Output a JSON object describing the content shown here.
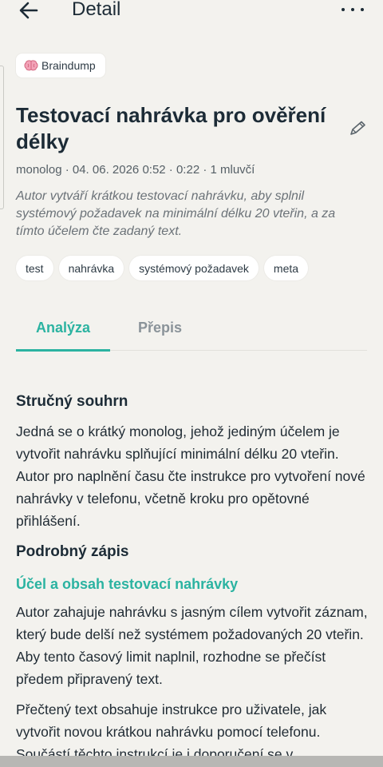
{
  "header": {
    "title": "Detail",
    "back_icon": "arrow-left-icon",
    "more_icon": "more-horizontal-icon"
  },
  "note": {
    "folder": "Braindump",
    "folder_icon": "brain-icon",
    "title": "Testovací nahrávka pro ověření délky",
    "edit_icon": "pencil-icon",
    "meta": "monolog · 04. 06. 2026 0:52 · 0:22 · 1 mluvčí",
    "summary": "Autor vytváří krátkou testovací nahrávku, aby splnil systémový požadavek na minimální délku 20 vteřin, a za tímto účelem čte zadaný text.",
    "tags": [
      "test",
      "nahrávka",
      "systémový požadavek",
      "meta"
    ]
  },
  "tabs": [
    {
      "label": "Analýza",
      "active": true
    },
    {
      "label": "Přepis",
      "active": false
    }
  ],
  "analysis": {
    "short_summary_heading": "Stručný souhrn",
    "short_summary": "Jedná se o krátký monolog, jehož jediným účelem je vytvořit nahrávku splňující minimální délku 20 vteřin. Autor pro naplnění času čte instrukce pro vytvoření nové nahrávky v telefonu, včetně kroku pro opětovné přihlášení.",
    "detail_heading": "Podrobný zápis",
    "section_heading": "Účel a obsah testovací nahrávky",
    "paragraph1": "Autor zahajuje nahrávku s jasným cílem vytvořit záznam, který bude delší než systémem požadovaných 20 vteřin. Aby tento časový limit naplnil, rozhodne se přečíst předem připravený text.",
    "paragraph2": "Přečtený text obsahuje instrukce pro uživatele, jak vytvořit novou krátkou nahrávku pomocí telefonu. Součástí těchto instrukcí je i doporučení se v"
  },
  "colors": {
    "accent": "#2bb3a1",
    "background": "#f3f2ee",
    "text": "#1c2b36"
  }
}
